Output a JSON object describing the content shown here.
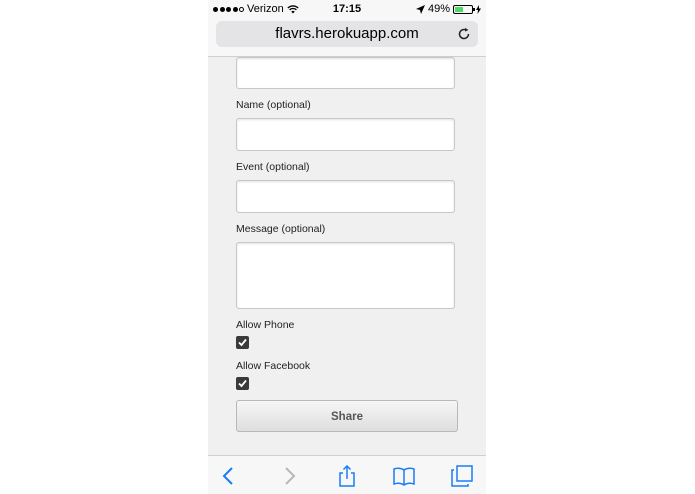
{
  "status_bar": {
    "carrier": "Verizon",
    "time": "17:15",
    "battery_percent": "49%",
    "battery_level": 0.49
  },
  "browser": {
    "url": "flavrs.herokuapp.com"
  },
  "form": {
    "name_label": "Name (optional)",
    "event_label": "Event (optional)",
    "message_label": "Message (optional)",
    "allow_phone_label": "Allow Phone",
    "allow_phone_checked": true,
    "allow_facebook_label": "Allow Facebook",
    "allow_facebook_checked": true,
    "share_label": "Share"
  },
  "toolbar": {
    "icons": [
      "back-icon",
      "forward-icon",
      "share-icon",
      "bookmarks-icon",
      "tabs-icon"
    ]
  },
  "colors": {
    "accent": "#1a7cf5",
    "page_background": "#f0f0f0",
    "battery_fill": "#4cd964"
  }
}
